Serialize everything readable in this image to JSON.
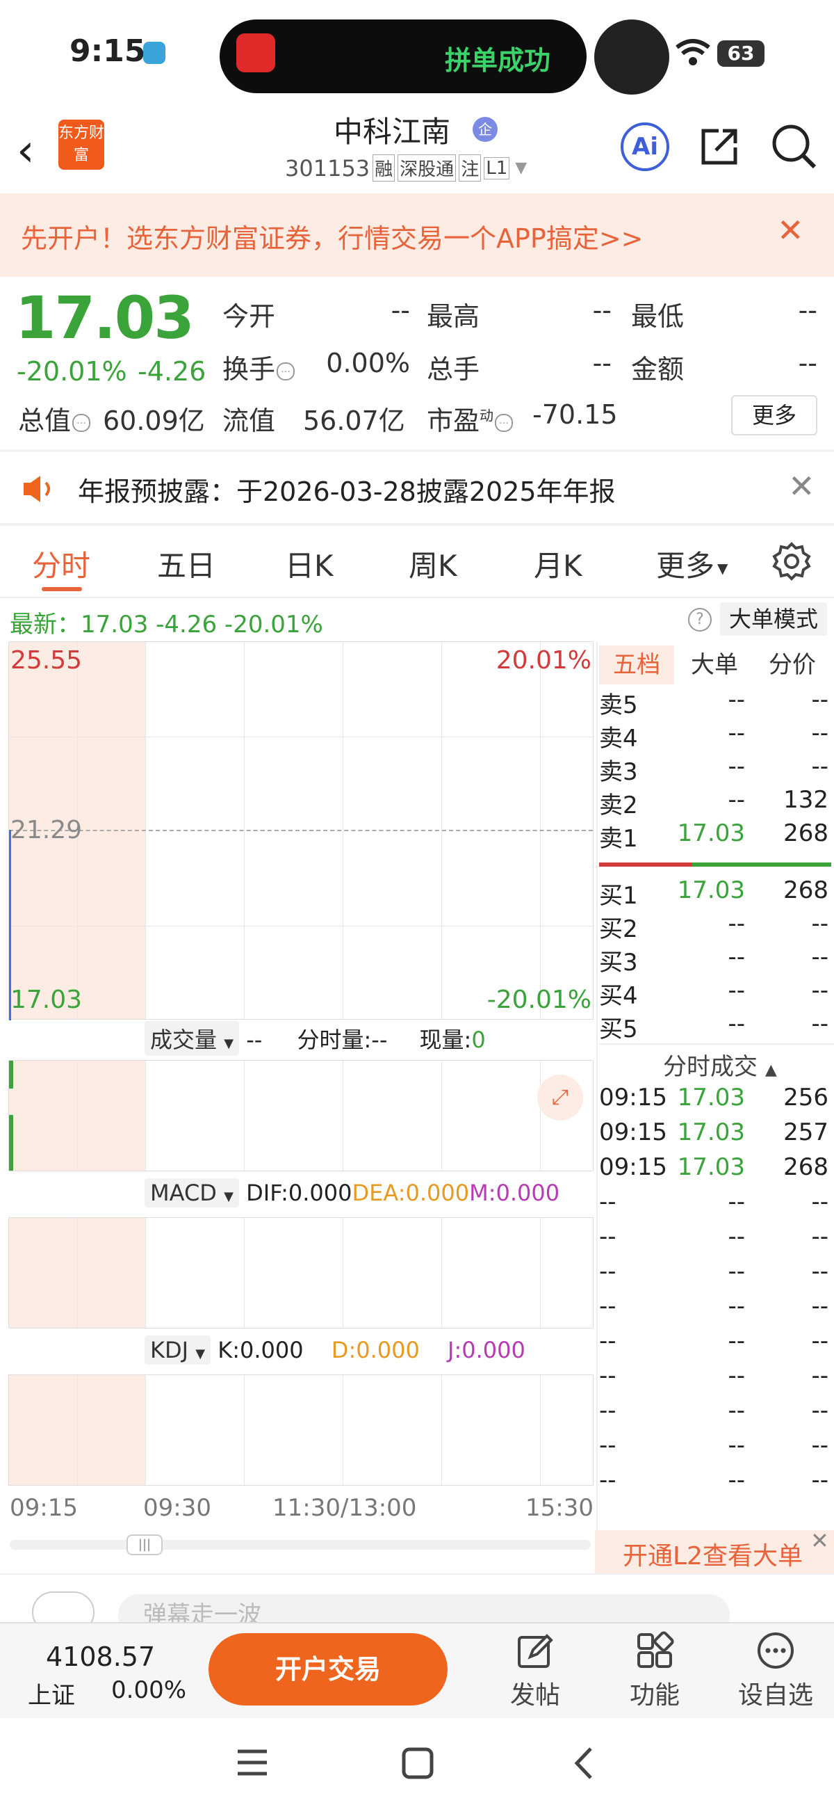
{
  "status_bar": {
    "time": "9:15",
    "island_text": "拼单成功",
    "battery": "63"
  },
  "header": {
    "logo_text": "东方财富",
    "stock_name": "中科江南",
    "qi_badge": "企",
    "stock_code": "301153",
    "tags": [
      "融",
      "深股通",
      "注",
      "L1"
    ],
    "ai_label": "Ai"
  },
  "banner": {
    "text": "先开户！选东方财富证券，行情交易一个APP搞定>>"
  },
  "quote": {
    "price": "17.03",
    "change_pct": "-20.01%",
    "change": "-4.26",
    "fields": {
      "open_label": "今开",
      "open": "--",
      "high_label": "最高",
      "high": "--",
      "low_label": "最低",
      "low": "--",
      "turnover_label": "换手",
      "turnover": "0.00%",
      "volume_label": "总手",
      "volume": "--",
      "amount_label": "金额",
      "amount": "--",
      "mktcap_label": "总值",
      "mktcap": "60.09亿",
      "float_label": "流值",
      "float": "56.07亿",
      "pe_label": "市盈",
      "pe_sup": "动",
      "pe": "-70.15"
    },
    "more_label": "更多"
  },
  "announcement": {
    "text": "年报预披露：于2026-03-28披露2025年年报"
  },
  "tabs": [
    "分时",
    "五日",
    "日K",
    "周K",
    "月K",
    "更多"
  ],
  "latest": {
    "text": "最新：17.03  -4.26  -20.01%",
    "big_order_mode": "大单模式"
  },
  "chart": {
    "price_high": "25.55",
    "price_mid": "21.29",
    "price_low": "17.03",
    "pct_high": "20.01%",
    "pct_low": "-20.01%",
    "volume_row": {
      "label": "成交量",
      "v1": "--",
      "v2_label": "分时量:",
      "v2": "--",
      "v3_label": "现量:",
      "v3": "0"
    },
    "macd_row": {
      "label": "MACD",
      "dif": "DIF:0.000",
      "dea": "DEA:0.000",
      "m": "M:0.000"
    },
    "kdj_row": {
      "label": "KDJ",
      "k": "K:0.000",
      "d": "D:0.000",
      "j": "J:0.000"
    },
    "time_axis": [
      "09:15",
      "09:30",
      "11:30/13:00",
      "15:30"
    ]
  },
  "order_book": {
    "tabs": [
      "五档",
      "大单",
      "分价"
    ],
    "asks": [
      {
        "label": "卖5",
        "price": "--",
        "vol": "--"
      },
      {
        "label": "卖4",
        "price": "--",
        "vol": "--"
      },
      {
        "label": "卖3",
        "price": "--",
        "vol": "--"
      },
      {
        "label": "卖2",
        "price": "--",
        "vol": "132"
      },
      {
        "label": "卖1",
        "price": "17.03",
        "vol": "268"
      }
    ],
    "bids": [
      {
        "label": "买1",
        "price": "17.03",
        "vol": "268"
      },
      {
        "label": "买2",
        "price": "--",
        "vol": "--"
      },
      {
        "label": "买3",
        "price": "--",
        "vol": "--"
      },
      {
        "label": "买4",
        "price": "--",
        "vol": "--"
      },
      {
        "label": "买5",
        "price": "--",
        "vol": "--"
      }
    ],
    "ticks_title": "分时成交",
    "ticks": [
      {
        "time": "09:15",
        "price": "17.03",
        "vol": "256"
      },
      {
        "time": "09:15",
        "price": "17.03",
        "vol": "257"
      },
      {
        "time": "09:15",
        "price": "17.03",
        "vol": "268"
      },
      {
        "time": "--",
        "price": "--",
        "vol": "--"
      },
      {
        "time": "--",
        "price": "--",
        "vol": "--"
      },
      {
        "time": "--",
        "price": "--",
        "vol": "--"
      },
      {
        "time": "--",
        "price": "--",
        "vol": "--"
      },
      {
        "time": "--",
        "price": "--",
        "vol": "--"
      },
      {
        "time": "--",
        "price": "--",
        "vol": "--"
      },
      {
        "time": "--",
        "price": "--",
        "vol": "--"
      },
      {
        "time": "--",
        "price": "--",
        "vol": "--"
      },
      {
        "time": "--",
        "price": "--",
        "vol": "--"
      }
    ],
    "l2_text": "开通L2查看大单"
  },
  "comment": {
    "placeholder": "弹幕走一波"
  },
  "bottom_bar": {
    "index_value": "4108.57",
    "index_name": "上证",
    "index_pct": "0.00%",
    "trade_button": "开户交易",
    "items": [
      "发帖",
      "功能",
      "设自选"
    ]
  },
  "colors": {
    "up": "#d23b3b",
    "down": "#3aa33a",
    "accent": "#f0651e",
    "dea": "#e79a23",
    "m": "#b63bb5"
  }
}
